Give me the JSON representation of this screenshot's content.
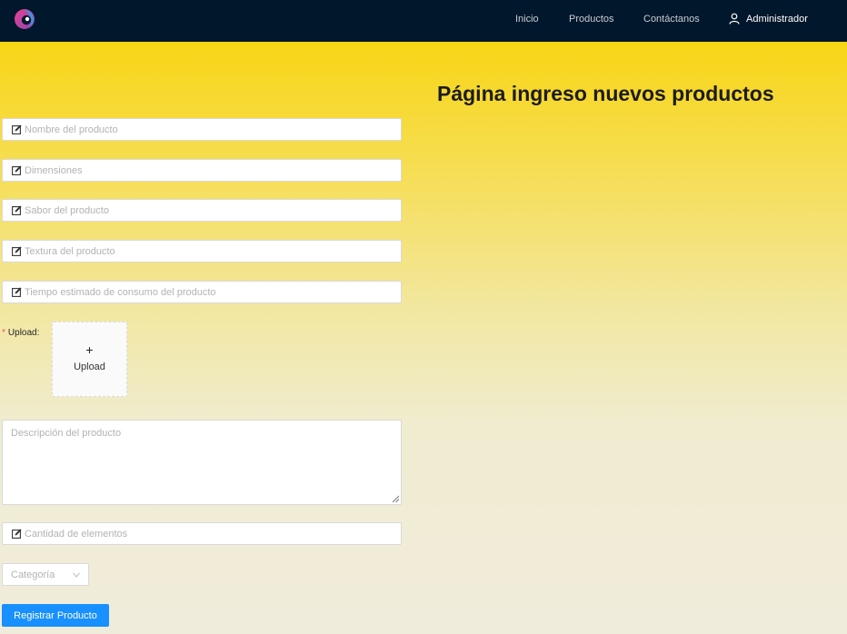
{
  "navbar": {
    "logo_icon": "brand-swirl-logo",
    "links": [
      "Inicio",
      "Productos",
      "Contáctanos"
    ],
    "user_icon": "user-icon",
    "user_label": "Administrador",
    "background": "#01172b"
  },
  "page": {
    "title": "Página ingreso nuevos productos"
  },
  "form": {
    "field_icon": "edit-icon",
    "fields": {
      "name": "Nombre del producto",
      "dimensions": "Dimensiones",
      "flavor": "Sabor del producto",
      "texture": "Textura del producto",
      "consumption_time": "Tiempo estimado de consumo del producto",
      "quantity": "Cantidad de elementos"
    },
    "upload": {
      "required_mark": "*",
      "label": "Upload",
      "colon": ":",
      "plus": "+",
      "button_text": "Upload"
    },
    "description_placeholder": "Descripción del producto",
    "category_placeholder": "Categoría",
    "submit_label": "Registrar Producto",
    "accent_color": "#1890ff"
  }
}
